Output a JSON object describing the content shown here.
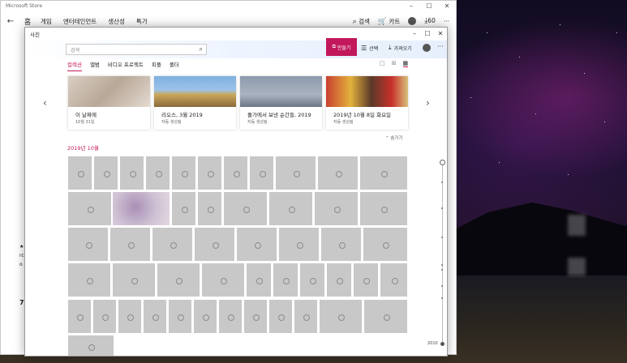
{
  "store": {
    "title": "Microsoft Store",
    "nav": {
      "home": "홈",
      "tabs": [
        "게임",
        "엔터테인먼트",
        "생산성",
        "특가"
      ]
    },
    "right": {
      "search": "검색",
      "cart": "카트",
      "downloads": "60"
    },
    "side_texts": [
      "★",
      "rc",
      "o",
      "7"
    ]
  },
  "photos": {
    "title": "사진",
    "search_placeholder": "검색",
    "header": {
      "create": "만들기",
      "select": "선택",
      "import": "가져오기"
    },
    "tabs": [
      "컬렉션",
      "앨범",
      "비디오 프로젝트",
      "피플",
      "폴더"
    ],
    "active_tab": "컬렉션",
    "memories": [
      {
        "title": "이 날짜에",
        "subtitle": "10월 31일"
      },
      {
        "title": "리오스, 3월 2019",
        "subtitle": "자동 생성됨"
      },
      {
        "title": "풀가에서 보낸 순간들, 2019",
        "subtitle": "자동 생성됨"
      },
      {
        "title": "2019년 10월 8일 화요일",
        "subtitle": "자동 생성됨"
      }
    ],
    "hide_label": "숨기기",
    "month_label": "2019년 10월",
    "year_label": "2010"
  },
  "colors": {
    "accent": "#c2185b",
    "tile": "#c8c8c8"
  }
}
